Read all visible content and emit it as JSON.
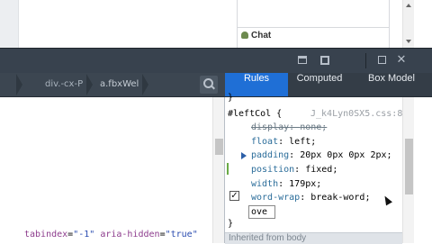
{
  "page": {
    "chat_label": "Chat"
  },
  "devtools": {
    "toolbar": {
      "close_glyph": "✕"
    },
    "breadcrumbs": [
      "div.-cx-P",
      "a.fbxWel"
    ],
    "tabs": [
      "Rules",
      "Computed",
      "Box Model"
    ],
    "active_tab": "Rules",
    "markup_line": {
      "attr1": "tabindex",
      "val1": "\"-1\"",
      "attr2": "aria-hidden",
      "val2": "\"true\""
    },
    "rules": {
      "brace_close_top": "}",
      "selector": "#leftCol {",
      "source": "J_k4Lyn0SX5.css:8",
      "declarations": [
        {
          "prop": "display",
          "value": "none",
          "struck": true
        },
        {
          "prop": "float",
          "value": "left"
        },
        {
          "prop": "padding",
          "value": "20px 0px 0px 2px"
        },
        {
          "prop": "position",
          "value": "fixed"
        },
        {
          "prop": "width",
          "value": "179px"
        },
        {
          "prop": "word-wrap",
          "value": "break-word",
          "checked": true
        }
      ],
      "editing_value": "ove",
      "brace_close": "}",
      "inherited_label": "Inherited from body"
    }
  },
  "colors": {
    "toolbar_bg": "#38424e",
    "tab_active_bg": "#1f6fd6",
    "property_color": "#2b6d9a"
  }
}
